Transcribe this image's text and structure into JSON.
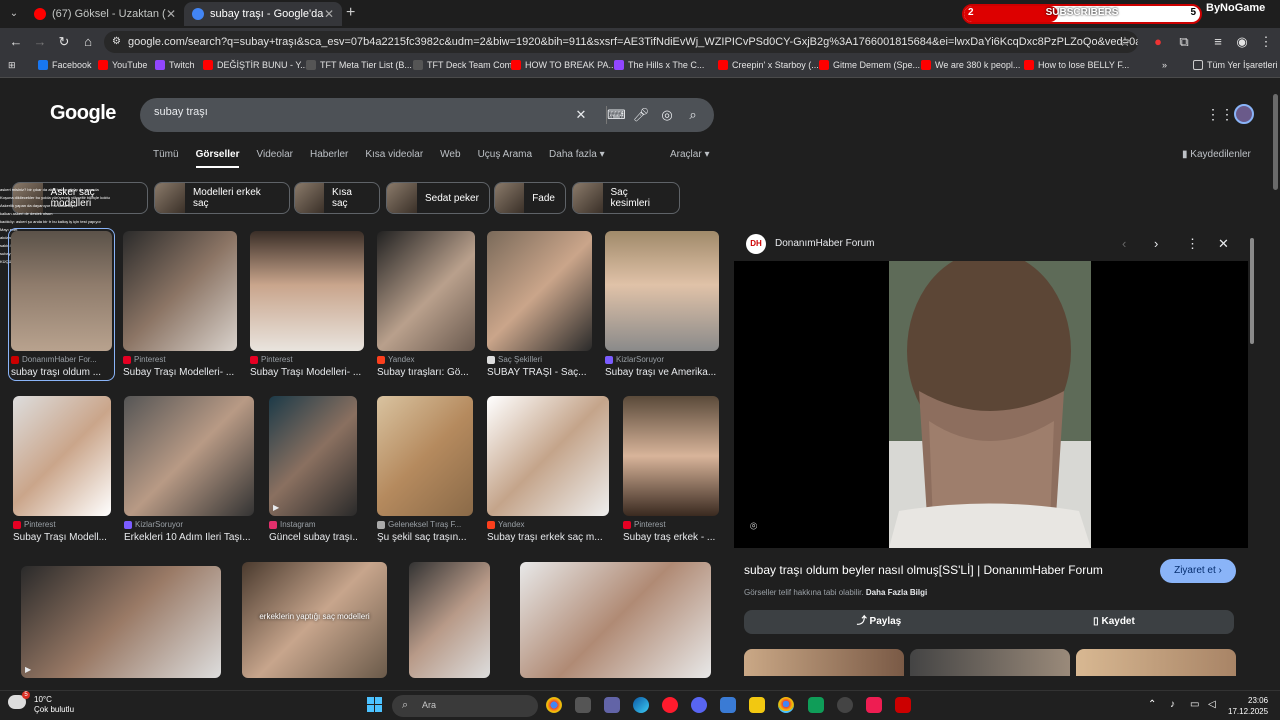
{
  "browser": {
    "tabs": [
      {
        "title": "(67) Göksel - Uzaktan (Official V",
        "favicon_color": "#ff0000"
      },
      {
        "title": "subay traşı - Google'da Ara",
        "favicon_color": "#4285f4"
      }
    ],
    "new_tab": "+",
    "url": "google.com/search?q=subay+traşı&sca_esv=07b4a2215fc3982c&udm=2&biw=1920&bih=911&sxsrf=AE3TifNdiEvWj_WZIPICvPSd0CY-GxjB2g%3A1766001815684&ei=lwxDaYi6KcqDxc8PzPLZoQo&ved=0ahUKEwjI4ZW3tcWRAxXKQfEDH..."
  },
  "overlay": {
    "subscribers_label": "SUBSCRIBERS",
    "sub_current": "2",
    "sub_goal": "5",
    "sub_progress": 0.4,
    "channel_name": "ByNoGame",
    "chat_lines": [
      "askeri misiniz? bir çıkar da aktif halde görüp de yanında",
      "Koşuna dikilecekler bu yolda yürüyecek yükseltir bilinçle koktu",
      "Askerlik yapan da dayanıyor mu kullanılıyor",
      "kalkan askeri de destek olsun",
      "kadıköy: askeri şu anda bir tr bu kalkış iş için test yapıyor",
      "Mayı evet",
      "akdan söz çocuk bu subay traşı yazı bakalım",
      "sakin lol şeç",
      "subay 3 deneye 5 yıl ile demek bir yerde",
      "KÜÇÜK ABDI ÖĞRETMEN"
    ]
  },
  "bookmarks": [
    {
      "label": "Facebook",
      "color": "#1877f2"
    },
    {
      "label": "YouTube",
      "color": "#ff0000"
    },
    {
      "label": "Twitch",
      "color": "#9146ff"
    },
    {
      "label": "DEĞİŞTİR BUNU - Y...",
      "color": "#ff0000"
    },
    {
      "label": "TFT Meta Tier List (B...",
      "color": "#444"
    },
    {
      "label": "TFT Deck Team Com...",
      "color": "#444"
    },
    {
      "label": "HOW TO BREAK PA...",
      "color": "#ff0000"
    },
    {
      "label": "The Hills x The C...",
      "color": "#9146ff"
    },
    {
      "label": "Creepin' x Starboy (...",
      "color": "#ff0000"
    },
    {
      "label": "Gitme Demem (Spe...",
      "color": "#ff0000"
    },
    {
      "label": "We are 380 k peopl...",
      "color": "#ff0000"
    },
    {
      "label": "How to lose BELLY F...",
      "color": "#ff0000"
    },
    {
      "label": "»",
      "color": ""
    },
    {
      "label": "Tüm Yer İşaretleri",
      "color": ""
    }
  ],
  "google": {
    "logo": "Google",
    "query": "subay traşı",
    "nav": [
      "Tümü",
      "Görseller",
      "Videolar",
      "Haberler",
      "Kısa videolar",
      "Web",
      "Uçuş Arama",
      "Daha fazla ▾"
    ],
    "tools": "Araçlar ▾",
    "saved": "Kaydedilenler",
    "chips": [
      "Asker saç modelleri",
      "Modelleri erkek saç",
      "Kısa saç",
      "Sedat peker",
      "Fade",
      "Saç kesimleri"
    ]
  },
  "results": [
    {
      "source": "DonanımHaber For...",
      "caption": "subay traşı oldum ...",
      "src_color": "#c00"
    },
    {
      "source": "Pinterest",
      "caption": "Subay Traşı Modelleri- ...",
      "src_color": "#e60023"
    },
    {
      "source": "Pinterest",
      "caption": "Subay Traşı Modelleri- ...",
      "src_color": "#e60023"
    },
    {
      "source": "Yandex",
      "caption": "Subay tıraşları: Gö...",
      "src_color": "#fc3f1d"
    },
    {
      "source": "Saç Şekilleri",
      "caption": "SUBAY TRAŞI - Saç...",
      "src_color": "#ddd"
    },
    {
      "source": "KizlarSoruyor",
      "caption": "Subay traşı ve Amerika...",
      "src_color": "#7b5cff"
    },
    {
      "source": "Pinterest",
      "caption": "Subay Traşı Modell...",
      "src_color": "#e60023"
    },
    {
      "source": "KizlarSoruyor",
      "caption": "Erkekleri 10 Adım İleri Taşı...",
      "src_color": "#7b5cff"
    },
    {
      "source": "Instagram",
      "caption": "Güncel subay traşı...",
      "src_color": "#e1306c"
    },
    {
      "source": "Geleneksel Tıraş F...",
      "caption": "Şu şekil saç traşın...",
      "src_color": "#aaa"
    },
    {
      "source": "Yandex",
      "caption": "Subay traşı erkek saç m...",
      "src_color": "#fc3f1d"
    },
    {
      "source": "Pinterest",
      "caption": "Subay traş erkek - ...",
      "src_color": "#e60023"
    }
  ],
  "bottom_row_overlay_text": "erkeklerin yaptığı saç modelleri",
  "panel": {
    "site_name": "DonanımHaber Forum",
    "site_icon": "DH",
    "title": "subay traşı oldum beyler nasıl olmuş[SS'Lİ] | DonanımHaber Forum",
    "visit": "Ziyaret et ›",
    "copyright": "Görseller telif hakkına tabi olabilir.",
    "more_info": "Daha Fazla Bilgi",
    "share": "Paylaş",
    "save": "Kaydet"
  },
  "taskbar": {
    "temp": "10°C",
    "weather": "Çok bulutlu",
    "weather_badge": "5",
    "search": "Ara",
    "time": "23:06",
    "date": "17.12.2025"
  }
}
